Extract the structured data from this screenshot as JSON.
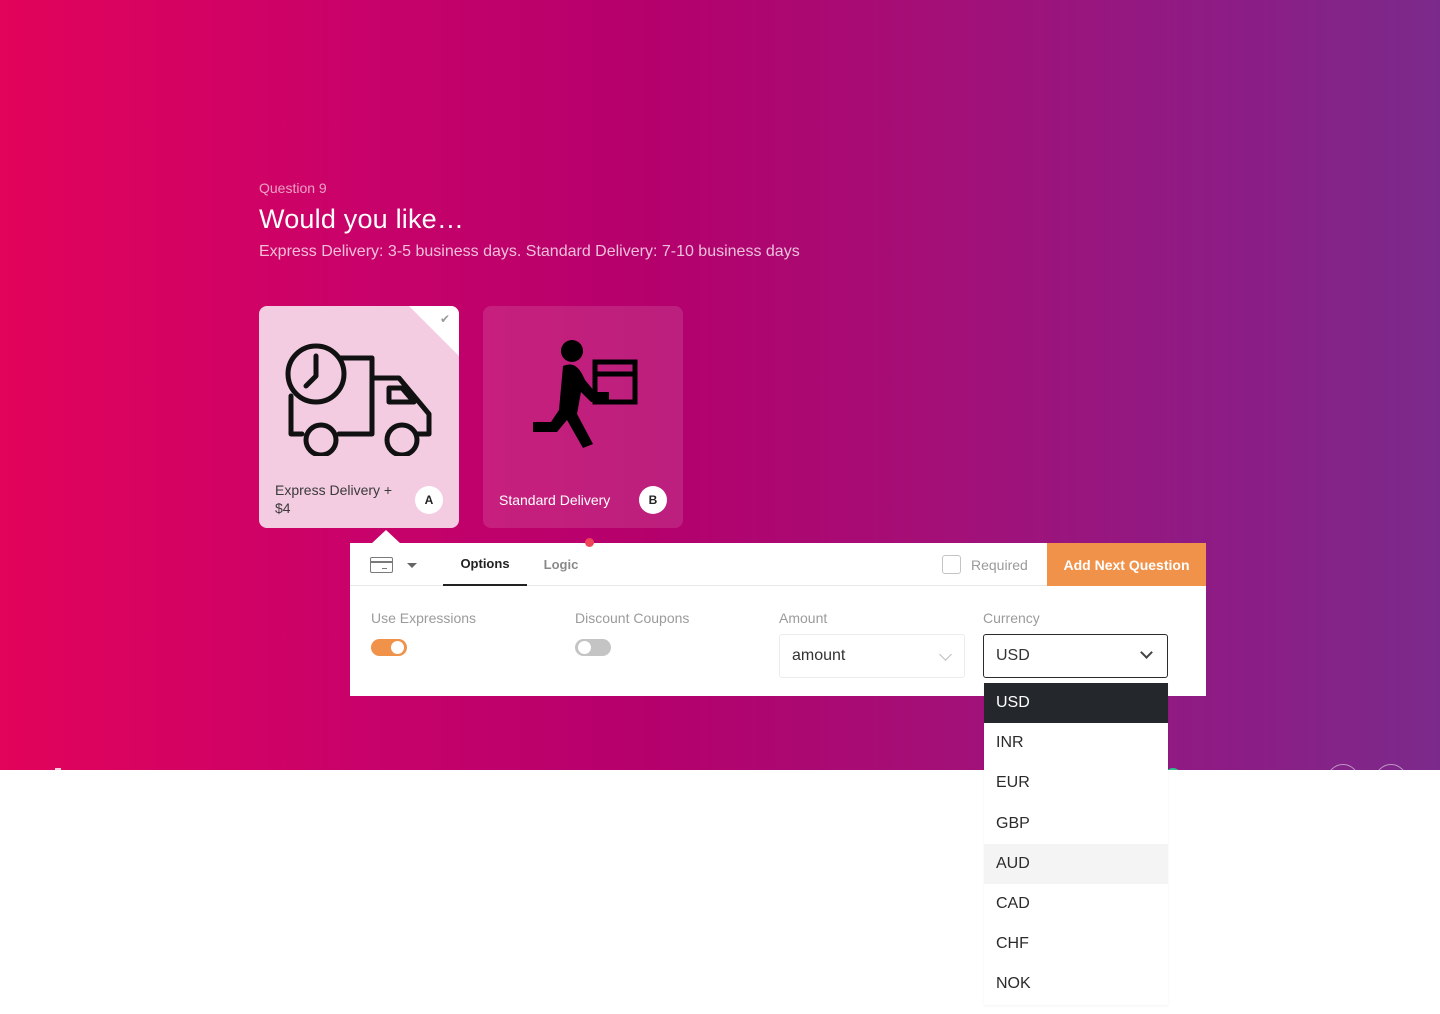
{
  "colors": {
    "gradient_start": "#e2035a",
    "gradient_mid": "#b5006c",
    "gradient_end": "#7b2a8b",
    "accent_orange": "#f0924a",
    "selected_option_bg": "#24282c",
    "notification_dot": "#f0445a"
  },
  "question": {
    "number_label": "Question 9",
    "title": "Would you like…",
    "description": "Express Delivery: 3-5 business days. Standard Delivery: 7-10 business days"
  },
  "choices": [
    {
      "label": "Express Delivery + $4",
      "key": "A",
      "icon": "delivery-truck-clock-icon",
      "selected": true
    },
    {
      "label": "Standard Delivery",
      "key": "B",
      "icon": "courier-running-with-box-icon",
      "selected": false
    }
  ],
  "editor": {
    "question_type_icon": "credit-card-icon",
    "tabs": [
      {
        "label": "Options",
        "active": true
      },
      {
        "label": "Logic",
        "active": false,
        "has_notification": true
      }
    ],
    "required_label": "Required",
    "required_checked": false,
    "add_next_label": "Add Next Question",
    "fields": {
      "use_expressions": {
        "label": "Use Expressions",
        "enabled": true
      },
      "discount_coupons": {
        "label": "Discount Coupons",
        "enabled": false
      },
      "amount": {
        "label": "Amount",
        "value": "amount"
      },
      "currency": {
        "label": "Currency",
        "value": "USD"
      }
    }
  },
  "currency_dropdown": {
    "options": [
      "USD",
      "INR",
      "EUR",
      "GBP",
      "AUD",
      "CAD",
      "CHF",
      "NOK"
    ],
    "selected": "USD",
    "hovered": "AUD"
  }
}
